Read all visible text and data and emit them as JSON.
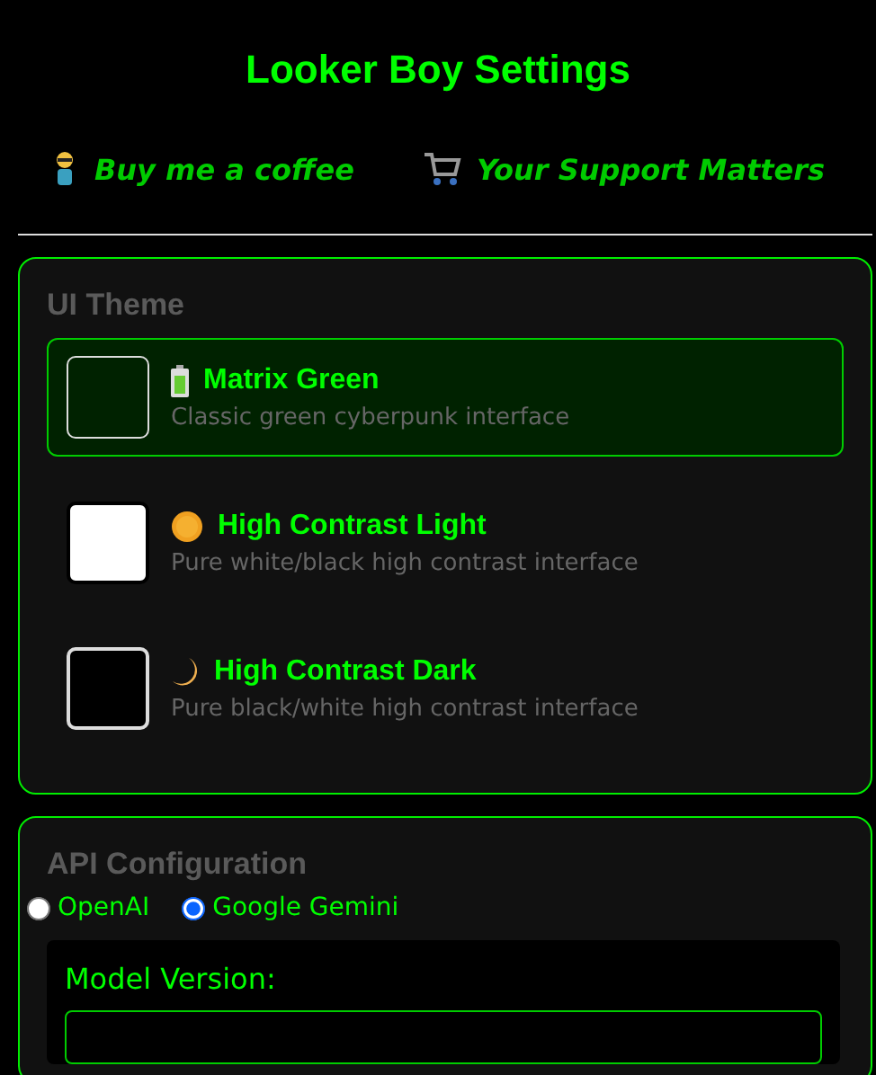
{
  "title": "Looker Boy Settings",
  "links": [
    {
      "kind": "person",
      "label": "Buy me a coffee"
    },
    {
      "kind": "cart",
      "label": "Your Support Matters"
    }
  ],
  "ui_theme": {
    "heading": "UI Theme",
    "options": [
      {
        "kind": "battery",
        "name": "Matrix Green",
        "description": "Classic green cyberpunk interface",
        "color": "#002200",
        "selected": true
      },
      {
        "kind": "sun",
        "name": "High Contrast Light",
        "description": "Pure white/black high contrast interface",
        "color": "#ffffff",
        "selected": false
      },
      {
        "kind": "moon",
        "name": "High Contrast Dark",
        "description": "Pure black/white high contrast interface",
        "color": "#000000",
        "selected": false
      }
    ]
  },
  "api": {
    "heading": "API Configuration",
    "providers": [
      {
        "label": "OpenAI",
        "selected": false
      },
      {
        "label": "Google Gemini",
        "selected": true
      }
    ],
    "model_label": "Model Version:"
  }
}
